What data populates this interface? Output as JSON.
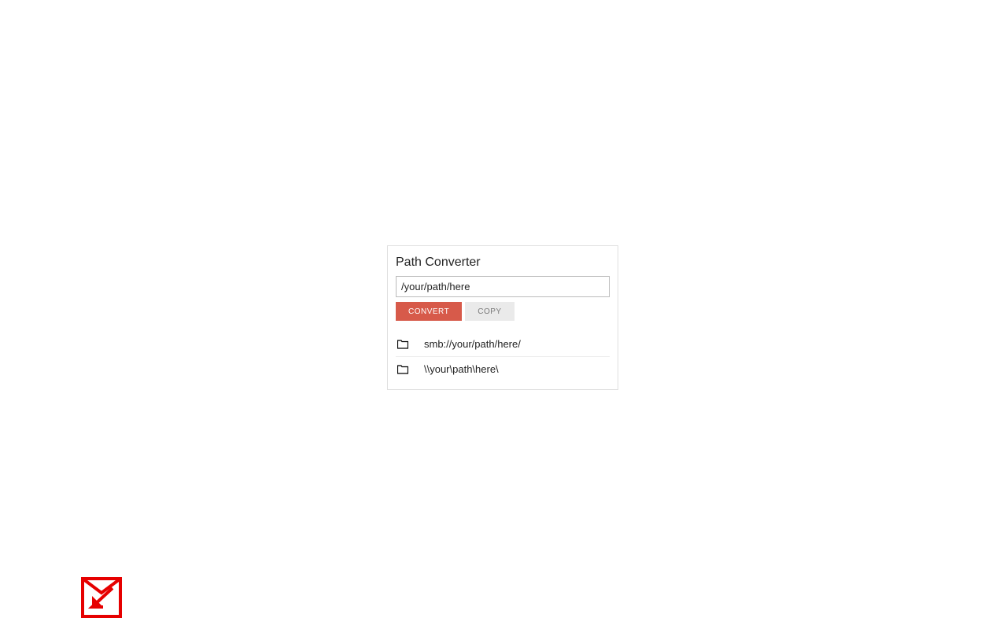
{
  "panel": {
    "title": "Path Converter",
    "input_value": "/your/path/here",
    "convert_label": "CONVERT",
    "copy_label": "COPY"
  },
  "results": {
    "smb": "smb://your/path/here/",
    "unc": "\\\\your\\path\\here\\"
  }
}
